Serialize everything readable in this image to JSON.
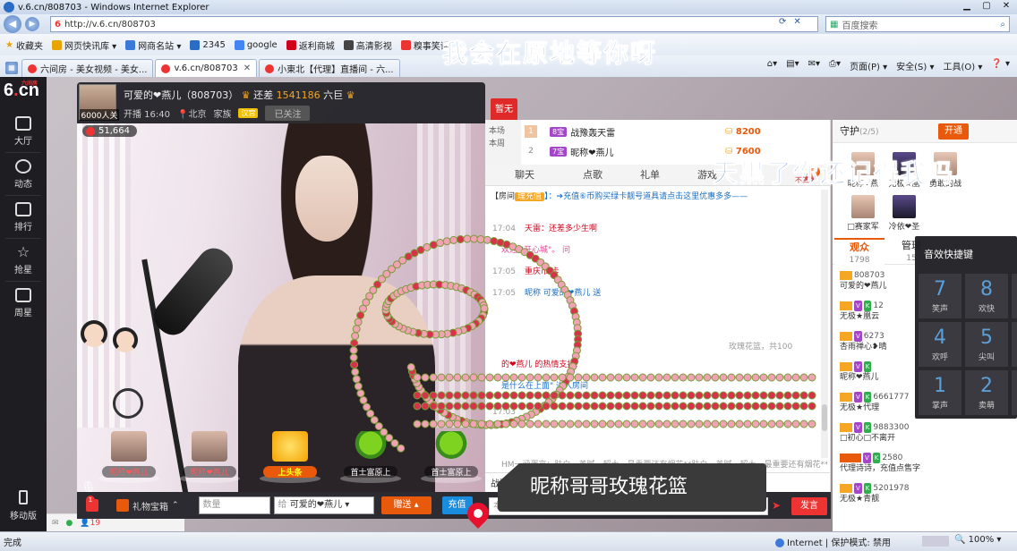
{
  "browser": {
    "window_title": "v.6.cn/808703 - Windows Internet Explorer",
    "address": "http://v.6.cn/808703",
    "search_placeholder": "百度搜索",
    "favorites_label": "收藏夹",
    "favorites": [
      "网页快讯库 ▾",
      "网商名站 ▾",
      "2345",
      "google",
      "返利商城",
      "高清影视",
      "糗事笑话"
    ],
    "tabs": [
      {
        "label": "六间房 - 美女视频 - 美女..."
      },
      {
        "label": "v.6.cn/808703"
      },
      {
        "label": "小東北【代理】直播间 - 六..."
      }
    ],
    "commands": [
      "页面(P) ▾",
      "安全(S) ▾",
      "工具(O) ▾",
      "❓ ▾"
    ],
    "status_left": "完成",
    "status_zone": "Internet | 保护模式: 禁用",
    "zoom": "🔍 100%  ▾"
  },
  "sidebar": {
    "logo_small": "六间房",
    "items": [
      "大厅",
      "动态",
      "排行",
      "抢星",
      "周星"
    ],
    "mobile": "移动版"
  },
  "anchor": {
    "name": "可爱的❤燕儿（808703）",
    "follow_prefix": "还差",
    "follow_count": "1541186",
    "follow_suffix": "六巨",
    "fans_badge": "6000人关",
    "start_time": "开播 16:40",
    "location": "📍北京",
    "family": "家族",
    "family_tag": "汉宫",
    "follow_btn": "已关注",
    "zanwu": "暂无",
    "hot_count": "51,664"
  },
  "gift_strip": [
    {
      "label": "昵称❤燕儿",
      "style": "red"
    },
    {
      "label": "昵称❤燕儿",
      "style": "red"
    },
    {
      "label": "上头条",
      "style": "gold"
    },
    {
      "label": "首士富原上",
      "style": "plain"
    },
    {
      "label": "首士富原上",
      "style": "plain"
    }
  ],
  "rank": {
    "tabs_text": "本场\n本周",
    "rows": [
      {
        "num": "1",
        "vip": "8宝",
        "name": "战豫轰天雷",
        "score": "8200"
      },
      {
        "num": "2",
        "vip": "7宝",
        "name": "昵称❤燕儿",
        "score": "7600"
      }
    ]
  },
  "chat": {
    "tabs": [
      "聊天",
      "点歌",
      "礼单",
      "游戏"
    ],
    "car_count": "7",
    "notice_prefix": "【房间",
    "notice_chip": "理充值",
    "notice_text": "】：➔充值⑥币购买绿卡靓号道具请点击这里优惠多多——",
    "messages": [
      {
        "time": "17:04",
        "body": "天雷：还差多少生啊"
      },
      {
        "time": "",
        "body": "欢迎 \"开心城\"。    问"
      },
      {
        "time": "17:05",
        "body": "重庆市        卡"
      },
      {
        "time": "17:05",
        "body": "昵称        可爱的❤燕儿 送"
      },
      {
        "time": "",
        "body": "玫瑰花篮，共100"
      },
      {
        "time": "",
        "body": "       的❤燕儿 的热情支持!"
      },
      {
        "time": "",
        "body": "是什么在上面\" 进入房间"
      },
      {
        "time": "17:03",
        "body": ""
      },
      {
        "time": "",
        "body": "HM一涵蛋京：肤白，美腻，超大，最重要还有烟花**肤白，美腻，超大，最重要还有烟花**肤"
      }
    ],
    "foot_name": "战豫轰天雷",
    "foot_close": "✕",
    "private": "悄悄",
    "input_placeholder": "本房间仅限一富及以上玩家公聊",
    "send": "发言"
  },
  "gift_bar": {
    "notif": "1",
    "gift_box": "礼物宝箱",
    "qty_placeholder": "数量",
    "to_label": "给",
    "to_value": "可爱的❤燕儿",
    "give": "赠送",
    "recharge": "充值"
  },
  "guard": {
    "title": "守护",
    "count": "(2/5)",
    "open": "开通",
    "members": [
      "昵称❤燕",
      "无极★凰",
      "勇敢的战",
      "□赛家军",
      "冷依❤圣"
    ]
  },
  "audience": {
    "tabs": [
      {
        "label": "观众",
        "sub": "1798"
      },
      {
        "label": "管理",
        "sub": "15"
      }
    ],
    "viewers": [
      {
        "id": "808703",
        "name": "可爱的❤燕儿"
      },
      {
        "id": "12",
        "name": "无极★凰云"
      },
      {
        "id": "6273",
        "name": "杏雨禅心❥晴"
      },
      {
        "id": "",
        "name": "昵称❤燕儿"
      },
      {
        "id": "6661777",
        "name": "无极★代理"
      },
      {
        "id": "9883300",
        "name": "□初心□不离开"
      },
      {
        "id": "2580",
        "name": "代理诗诗，充值点售字"
      },
      {
        "id": "5201978",
        "name": "无极★青靓"
      }
    ],
    "foot_count": "19"
  },
  "sfx": {
    "title": "音效快捷键",
    "keys": [
      {
        "digit": "7",
        "name": "笑声"
      },
      {
        "digit": "8",
        "name": "欢快"
      },
      {
        "digit": "4",
        "name": "欢呼"
      },
      {
        "digit": "5",
        "name": "尖叫"
      },
      {
        "digit": "1",
        "name": "掌声"
      },
      {
        "digit": "2",
        "name": "卖萌"
      }
    ]
  },
  "overlay": {
    "banner1": "我会在原地等你呀",
    "banner2": "天黑了你还记得我吗",
    "banner2_sub": "不三",
    "gift_tooltip": "昵称哥哥玫瑰花篮"
  }
}
